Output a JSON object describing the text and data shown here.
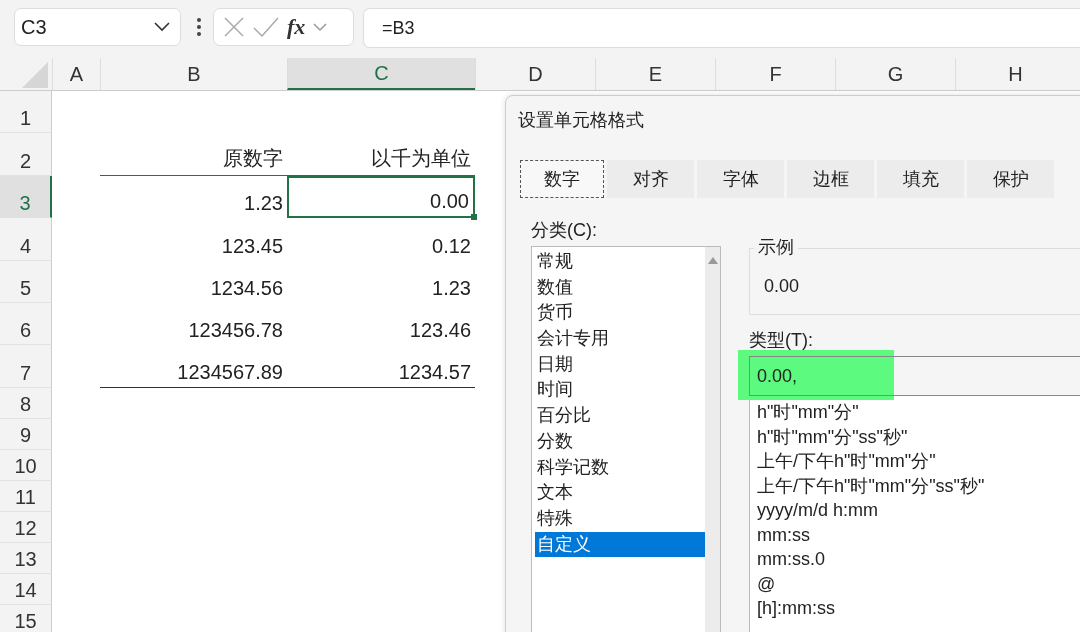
{
  "name_box": {
    "value": "C3"
  },
  "formula_bar": {
    "fx": "fx",
    "value": "=B3"
  },
  "columns": [
    {
      "label": "A",
      "selected": false
    },
    {
      "label": "B",
      "selected": false
    },
    {
      "label": "C",
      "selected": true
    },
    {
      "label": "D",
      "selected": false
    },
    {
      "label": "E",
      "selected": false
    },
    {
      "label": "F",
      "selected": false
    },
    {
      "label": "G",
      "selected": false
    },
    {
      "label": "H",
      "selected": false
    }
  ],
  "rows": [
    {
      "label": "1",
      "selected": false,
      "cells": []
    },
    {
      "label": "2",
      "selected": false,
      "cells": [
        {
          "text": "原数字",
          "selected": false
        },
        {
          "text": "以千为单位",
          "selected": false
        }
      ]
    },
    {
      "label": "3",
      "selected": true,
      "cells": [
        {
          "text": "1.23",
          "selected": false
        },
        {
          "text": "0.00",
          "selected": true
        }
      ]
    },
    {
      "label": "4",
      "selected": false,
      "cells": [
        {
          "text": "123.45",
          "selected": false
        },
        {
          "text": "0.12",
          "selected": false
        }
      ]
    },
    {
      "label": "5",
      "selected": false,
      "cells": [
        {
          "text": "1234.56",
          "selected": false
        },
        {
          "text": "1.23",
          "selected": false
        }
      ]
    },
    {
      "label": "6",
      "selected": false,
      "cells": [
        {
          "text": "123456.78",
          "selected": false
        },
        {
          "text": "123.46",
          "selected": false
        }
      ]
    },
    {
      "label": "7",
      "selected": false,
      "cells": [
        {
          "text": "1234567.89",
          "selected": false
        },
        {
          "text": "1234.57",
          "selected": false
        }
      ]
    },
    {
      "label": "8",
      "selected": false,
      "cells": []
    },
    {
      "label": "9",
      "selected": false,
      "cells": []
    },
    {
      "label": "10",
      "selected": false,
      "cells": []
    },
    {
      "label": "11",
      "selected": false,
      "cells": []
    },
    {
      "label": "12",
      "selected": false,
      "cells": []
    },
    {
      "label": "13",
      "selected": false,
      "cells": []
    },
    {
      "label": "14",
      "selected": false,
      "cells": []
    },
    {
      "label": "15",
      "selected": false,
      "cells": []
    }
  ],
  "dialog": {
    "title": "设置单元格格式",
    "tabs": [
      {
        "label": "数字",
        "selected": true
      },
      {
        "label": "对齐",
        "selected": false
      },
      {
        "label": "字体",
        "selected": false
      },
      {
        "label": "边框",
        "selected": false
      },
      {
        "label": "填充",
        "selected": false
      },
      {
        "label": "保护",
        "selected": false
      }
    ],
    "category_label": "分类(C):",
    "categories": [
      {
        "label": "常规",
        "selected": false
      },
      {
        "label": "数值",
        "selected": false
      },
      {
        "label": "货币",
        "selected": false
      },
      {
        "label": "会计专用",
        "selected": false
      },
      {
        "label": "日期",
        "selected": false
      },
      {
        "label": "时间",
        "selected": false
      },
      {
        "label": "百分比",
        "selected": false
      },
      {
        "label": "分数",
        "selected": false
      },
      {
        "label": "科学记数",
        "selected": false
      },
      {
        "label": "文本",
        "selected": false
      },
      {
        "label": "特殊",
        "selected": false
      },
      {
        "label": "自定义",
        "selected": true
      }
    ],
    "sample": {
      "label": "示例",
      "value": "0.00"
    },
    "type_label": "类型(T):",
    "type_value": "0.00,",
    "type_options": [
      "h\"时\"mm\"分\"",
      "h\"时\"mm\"分\"ss\"秒\"",
      "上午/下午h\"时\"mm\"分\"",
      "上午/下午h\"时\"mm\"分\"ss\"秒\"",
      "yyyy/m/d h:mm",
      "mm:ss",
      "mm:ss.0",
      "@",
      "[h]:mm:ss"
    ]
  }
}
